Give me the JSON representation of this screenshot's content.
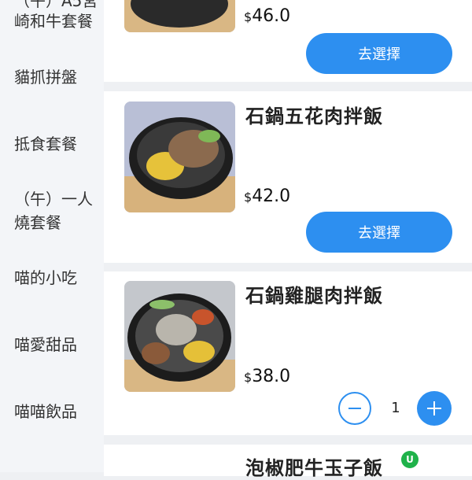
{
  "sidebar": {
    "items": [
      {
        "label": "（午）A5宮"
      },
      {
        "label": "崎和牛套餐"
      },
      {
        "label": "貓抓拼盤"
      },
      {
        "label": "抵食套餐"
      },
      {
        "label": "（午）一人"
      },
      {
        "label": "燒套餐"
      },
      {
        "label": "喵的小吃"
      },
      {
        "label": "喵愛甜品"
      },
      {
        "label": "喵喵飲品"
      }
    ]
  },
  "menu": {
    "currency_symbol": "$",
    "items": [
      {
        "name": "",
        "price": "46.0",
        "button_label": "去選擇"
      },
      {
        "name": "石鍋五花肉拌飯",
        "price": "42.0",
        "button_label": "去選擇"
      },
      {
        "name": "石鍋雞腿肉拌飯",
        "price": "38.0",
        "quantity": "1"
      },
      {
        "name": "泡椒肥牛玉子飯",
        "badge": "U"
      }
    ]
  },
  "colors": {
    "accent": "#2d8ff0",
    "badge": "#1fb24a"
  }
}
